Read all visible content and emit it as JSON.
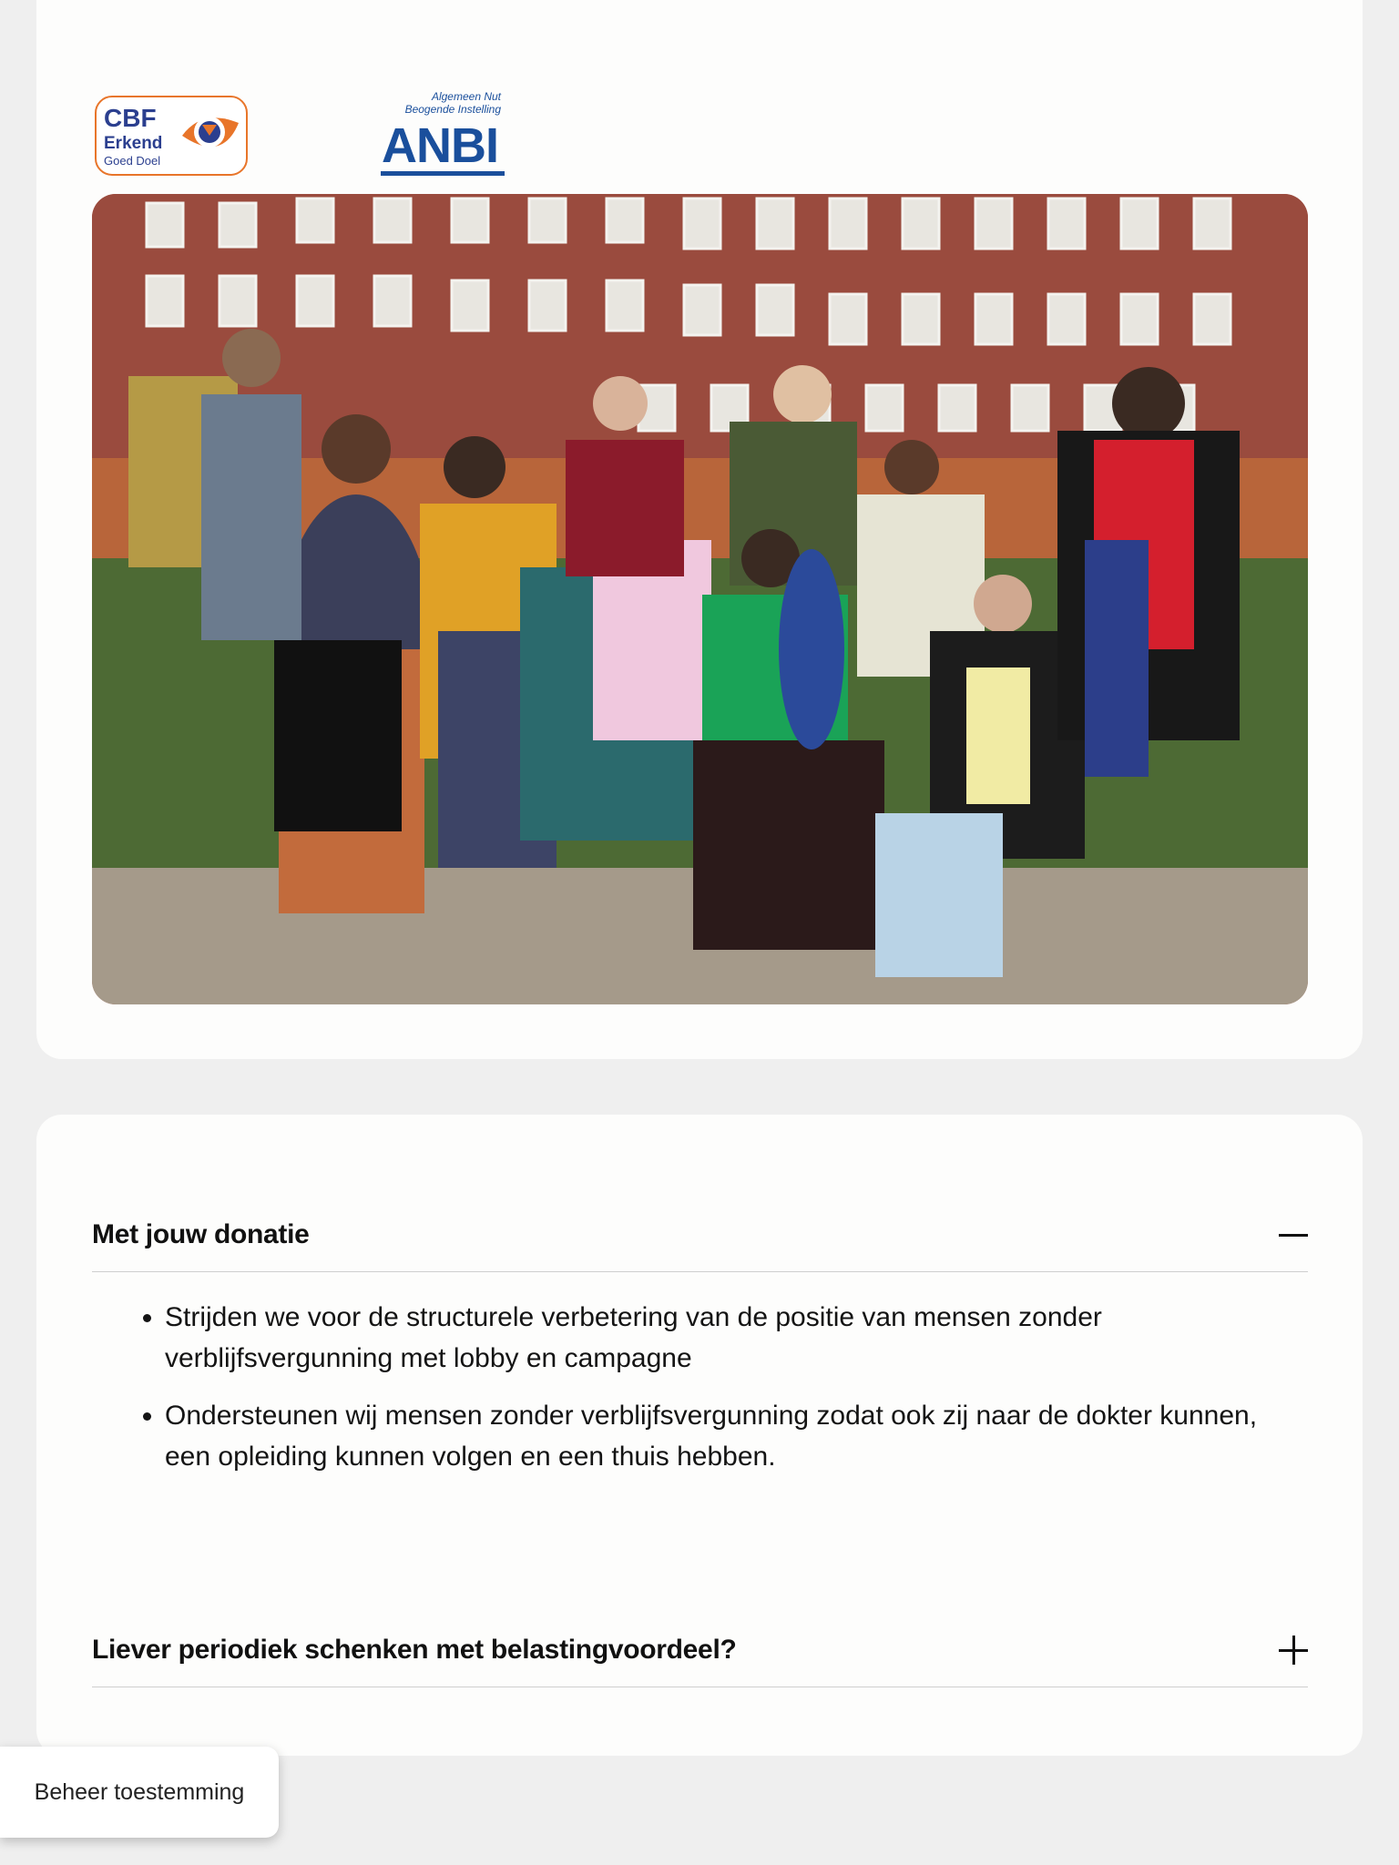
{
  "logos": {
    "cbf": {
      "line1": "CBF",
      "line2": "Erkend",
      "line3": "Goed Doel"
    },
    "anbi": {
      "subtitle_line1": "Algemeen Nut",
      "subtitle_line2": "Beogende Instelling",
      "name": "ANBI"
    }
  },
  "photo": {
    "description_icon": "group-photo"
  },
  "accordion": [
    {
      "title": "Met jouw donatie",
      "state": "expanded",
      "items": [
        "Strijden we voor de structurele verbetering van de positie van mensen zonder verblijfsvergunning met lobby en campagne",
        "Ondersteunen wij mensen zonder verblijfsvergunning zodat ook zij naar de dokter kunnen, een opleiding kunnen volgen en een thuis hebben."
      ]
    },
    {
      "title": "Liever periodiek schenken met belastingvoordeel?",
      "state": "collapsed"
    }
  ],
  "consent_button": "Beheer toestemming",
  "colors": {
    "background": "#efefef",
    "card": "#fdfdfc",
    "cbf_blue": "#2b3f8f",
    "cbf_orange": "#e8752a",
    "anbi_blue": "#1a4f9c"
  }
}
